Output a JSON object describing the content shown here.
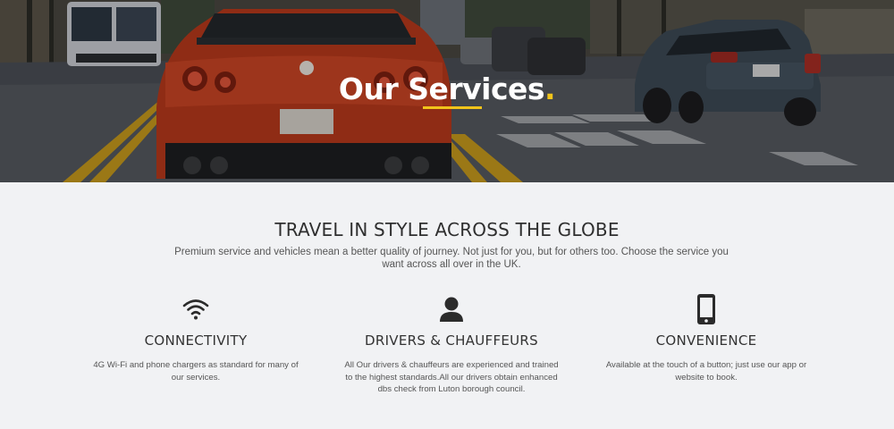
{
  "hero": {
    "title": "Our Services",
    "title_dot": "."
  },
  "section": {
    "heading": "TRAVEL IN STYLE ACROSS THE GLOBE",
    "subheading": "Premium service and vehicles mean a better quality of journey. Not just for you, but for others too. Choose the service you want across all over in the UK."
  },
  "features": [
    {
      "icon": "wifi-icon",
      "title": "CONNECTIVITY",
      "description": "4G Wi-Fi and phone chargers as standard for many of our services."
    },
    {
      "icon": "user-icon",
      "title": "DRIVERS & CHAUFFEURS",
      "description": "All Our drivers & chauffeurs are experienced and trained to the highest standards.All our drivers obtain enhanced dbs check from Luton borough council."
    },
    {
      "icon": "smartphone-icon",
      "title": "CONVENIENCE",
      "description": "Available at the touch of a button; just use our app or website to book."
    }
  ],
  "colors": {
    "accent": "#f2c41a",
    "background": "#f1f2f4",
    "car_red": "#b8391c"
  }
}
